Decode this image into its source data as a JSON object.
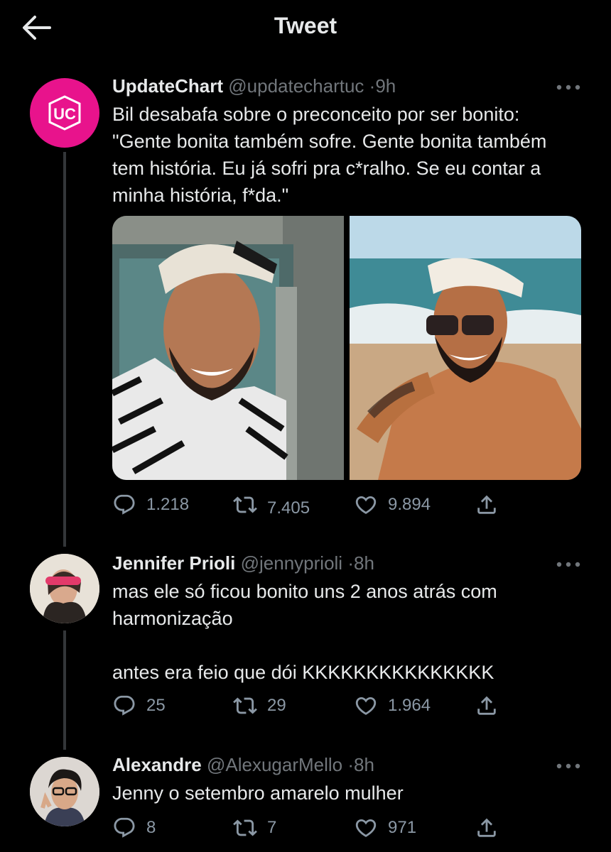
{
  "header": {
    "title": "Tweet"
  },
  "main_tweet": {
    "name": "UpdateChart",
    "handle": "@updatechartuc",
    "separator": "·",
    "time": "9h",
    "text": "Bil desabafa sobre o preconceito por ser bonito:\n\"Gente bonita também sofre. Gente bonita também tem história. Eu já sofri pra c*ralho. Se eu contar a minha história, f*da.\"",
    "avatar_letters": "UC",
    "replies": "1.218",
    "retweets": "7.405",
    "likes": "9.894"
  },
  "reply1": {
    "name": "Jennifer Prioli",
    "handle": "@jennyprioli",
    "separator": "·",
    "time": "8h",
    "text": "mas ele só ficou bonito uns 2 anos atrás com harmonização\n\nantes era feio que dói KKKKKKKKKKKKKKK",
    "replies": "25",
    "retweets": "29",
    "likes": "1.964"
  },
  "reply2": {
    "name": "Alexandre",
    "handle": "@AlexugarMello",
    "separator": "·",
    "time": "8h",
    "text": "Jenny o setembro amarelo mulher",
    "replies": "8",
    "retweets": "7",
    "likes": "971"
  },
  "colors": {
    "background": "#000000",
    "text": "#e7e9ea",
    "secondary": "#71767b",
    "brand_avatar": "#e8138c"
  },
  "icons": [
    "back-arrow-icon",
    "more-icon",
    "reply-icon",
    "retweet-icon",
    "like-icon",
    "share-icon"
  ]
}
